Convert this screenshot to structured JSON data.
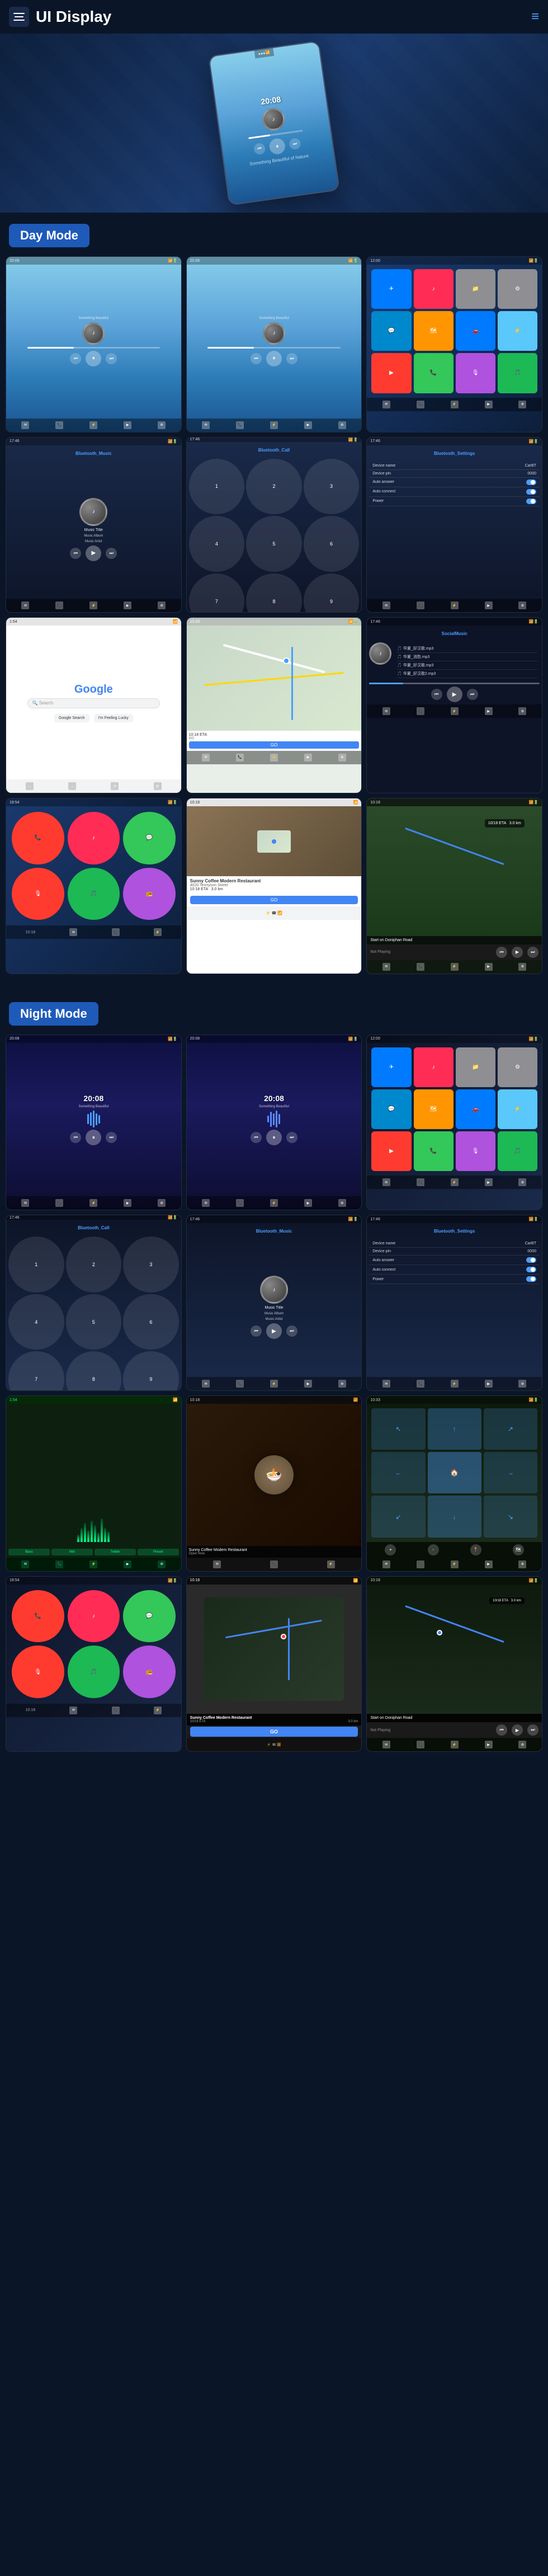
{
  "header": {
    "title": "UI Display",
    "menu_label": "menu",
    "nav_icon": "≡"
  },
  "sections": {
    "day_mode": {
      "label": "Day Mode",
      "color": "#1e5ab8"
    },
    "night_mode": {
      "label": "Night Mode",
      "color": "#1e5ab8"
    }
  },
  "hero": {
    "time": "20:08",
    "subtitle": "Something Beautiful of Nature"
  },
  "day_screens": [
    {
      "id": "day-music-1",
      "type": "music-day",
      "time": "20:08",
      "subtitle": "Something Beautiful"
    },
    {
      "id": "day-music-2",
      "type": "music-day",
      "time": "20:08",
      "subtitle": "Something Beautiful"
    },
    {
      "id": "day-apps",
      "type": "apps-day"
    },
    {
      "id": "day-bt-music",
      "type": "bluetooth-music",
      "title": "Bluetooth_Music",
      "music_title": "Music Title",
      "music_album": "Music Album",
      "music_artist": "Music Artist"
    },
    {
      "id": "day-bt-call",
      "type": "bluetooth-call",
      "title": "Bluetooth_Call"
    },
    {
      "id": "day-bt-settings",
      "type": "bluetooth-settings",
      "title": "Bluetooth_Settings",
      "device_name_label": "Device name",
      "device_name_val": "CarBT",
      "device_pin_label": "Device pin",
      "device_pin_val": "0000",
      "auto_answer_label": "Auto answer",
      "auto_connect_label": "Auto connect",
      "power_label": "Power"
    },
    {
      "id": "day-google",
      "type": "google"
    },
    {
      "id": "day-waze",
      "type": "waze"
    },
    {
      "id": "day-social",
      "type": "social-music",
      "title": "SocialMusic",
      "songs": [
        "华夏_好汉歌.mp3",
        "华夏_消愁.mp3",
        "华夏_好汉歌.mp3",
        "华夏_好汉歌2.mp3"
      ]
    },
    {
      "id": "day-carplay-apps",
      "type": "carplay-apps"
    },
    {
      "id": "day-restaurant",
      "type": "restaurant",
      "name": "Sunny Coffee Modern Restaurant",
      "address": "4020 Tennyson Street",
      "eta": "10:18 ETA",
      "distance": "3.0 km",
      "go_label": "GO"
    },
    {
      "id": "day-nav",
      "type": "navigation",
      "distance": "10/18 ETA",
      "road": "3.0 km",
      "instruction": "Start on Doniphan Road",
      "status": "Not Playing"
    }
  ],
  "night_screens": [
    {
      "id": "night-music-1",
      "type": "music-night",
      "time": "20:08",
      "subtitle": "Something Beautiful"
    },
    {
      "id": "night-music-2",
      "type": "music-night",
      "time": "20:08",
      "subtitle": "Something Beautiful"
    },
    {
      "id": "night-apps",
      "type": "apps-night"
    },
    {
      "id": "night-bt-call",
      "type": "bluetooth-call-night",
      "title": "Bluetooth_Call"
    },
    {
      "id": "night-bt-music",
      "type": "bluetooth-music-night",
      "title": "Bluetooth_Music",
      "music_title": "Music Title",
      "music_album": "Music Album",
      "music_artist": "Music Artist"
    },
    {
      "id": "night-bt-settings",
      "type": "bluetooth-settings-night",
      "title": "Bluetooth_Settings",
      "device_name_label": "Device name",
      "device_name_val": "CarBT",
      "device_pin_label": "Device pin",
      "device_pin_val": "0000",
      "auto_answer_label": "Auto answer",
      "auto_connect_label": "Auto connect",
      "power_label": "Power"
    },
    {
      "id": "night-eq",
      "type": "equalizer"
    },
    {
      "id": "night-restaurant-img",
      "type": "restaurant-night"
    },
    {
      "id": "night-nav-dark",
      "type": "navigation-night"
    },
    {
      "id": "night-carplay-apps",
      "type": "carplay-apps-night"
    },
    {
      "id": "night-restaurant-2",
      "type": "restaurant-night-2",
      "name": "Sunny Coffee Modern Restaurant",
      "eta": "10/18 ETA",
      "distance": "3.0 km",
      "go_label": "GO"
    },
    {
      "id": "night-nav-2",
      "type": "navigation-night-2",
      "instruction": "Start on Doniphan Road",
      "status": "Not Playing"
    }
  ],
  "app_colors": {
    "phone": "#34c759",
    "messages": "#34c759",
    "music": "#ff2d55",
    "maps": "#4285f4",
    "settings": "#8e8e93",
    "bt": "#007aff",
    "telegram": "#0088cc",
    "whatsapp": "#25d366",
    "youtube": "#ff0000",
    "spotify": "#1db954",
    "podcast": "#9b59b6",
    "radio": "#e74c3c"
  }
}
